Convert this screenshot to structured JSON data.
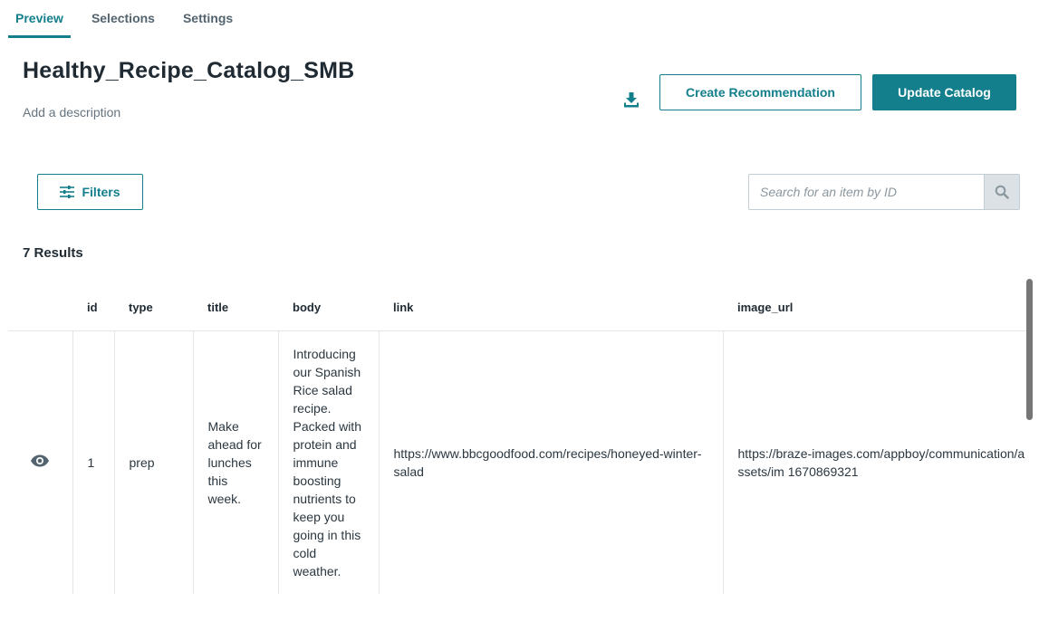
{
  "tabs": [
    {
      "label": "Preview",
      "active": true
    },
    {
      "label": "Selections",
      "active": false
    },
    {
      "label": "Settings",
      "active": false
    }
  ],
  "catalog": {
    "title": "Healthy_Recipe_Catalog_SMB",
    "description_placeholder": "Add a description"
  },
  "actions": {
    "download_icon": "download-icon",
    "create_label": "Create Recommendation",
    "update_label": "Update Catalog"
  },
  "filters": {
    "label": "Filters",
    "icon": "sliders-icon"
  },
  "search": {
    "placeholder": "Search for an item by ID",
    "value": "",
    "icon": "search-icon"
  },
  "results": {
    "count_label": "7 Results"
  },
  "table": {
    "columns": [
      "id",
      "type",
      "title",
      "body",
      "link",
      "image_url"
    ],
    "rows": [
      {
        "id": "1",
        "type": "prep",
        "title": "Make ahead for lunches this week.",
        "body": "Introducing our Spanish Rice salad recipe. Packed with protein and immune boosting nutrients to keep you going in this cold weather.",
        "link": "https://www.bbcgoodfood.com/recipes/honeyed-winter-salad",
        "image_url": "https://braze-images.com/appboy/communication/assets/im 1670869321"
      }
    ]
  },
  "colors": {
    "accent": "#137f8c",
    "text": "#1f2a33",
    "muted": "#66747f",
    "border": "#e2e7ea"
  }
}
